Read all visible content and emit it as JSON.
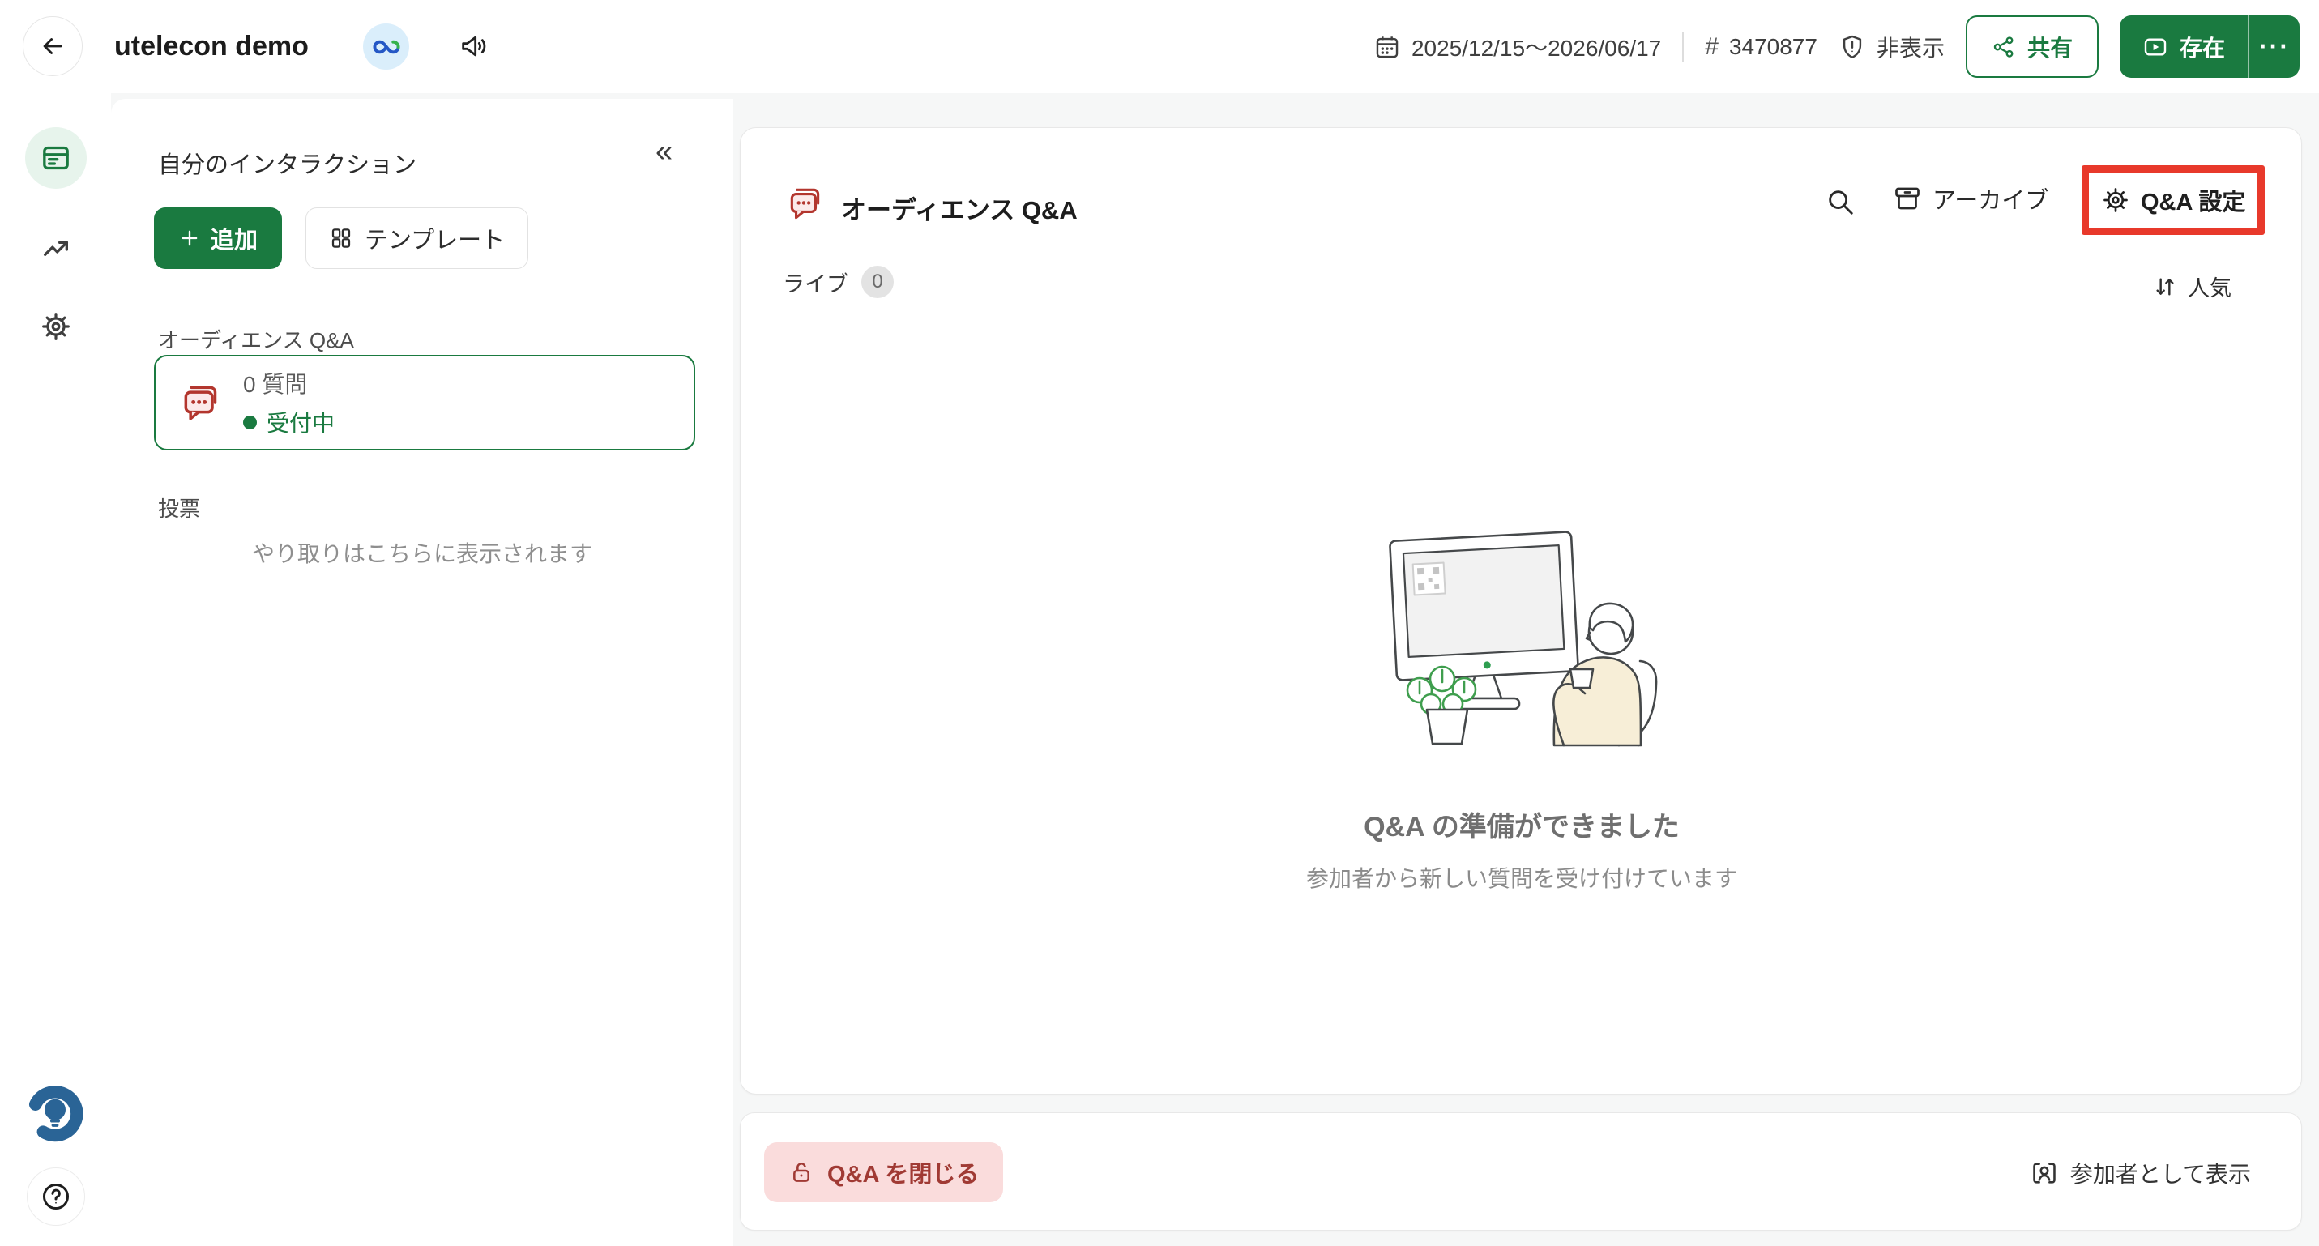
{
  "colors": {
    "green": "#1a7a40",
    "pale-green": "#e7f4ec",
    "qa-red": "#b3362e",
    "qa-pink": "#fceaea",
    "highlight-red": "#e8392b",
    "pink-bg": "#fadcdc",
    "maroon": "#a03a34",
    "slido-blue": "#2a6496",
    "badge-bg": "#e3e3e3"
  },
  "icons": {
    "back-icon": "arrow-left",
    "webex-logo": "infinity-loops",
    "announcement-icon": "speaker-waves",
    "calendar-icon": "calendar",
    "shield-alert-icon": "shield-exclamation",
    "share-icon": "share-nodes",
    "present-icon": "play-screen",
    "more-icon": "ellipsis",
    "interactions-icon": "panel-lines",
    "analytics-icon": "trend-up-arrow",
    "settings-icon": "gear",
    "slido-logo": "bulb-in-arc",
    "help-icon": "question-circle",
    "collapse-icon": "double-chevron-left",
    "add-icon": "plus",
    "template-icon": "grid-2x2",
    "qa-icon": "chat-bubbles",
    "search-icon": "magnifier",
    "archive-icon": "archive-box",
    "sort-icon": "arrows-down-up",
    "unlock-icon": "open-padlock",
    "participant-icon": "person-badge"
  },
  "topbar": {
    "title": "utelecon demo",
    "date_range": "2025/12/15〜2026/06/17",
    "hash_symbol": "#",
    "event_code": "3470877",
    "hidden_label": "非表示",
    "share_label": "共有",
    "present_label": "存在",
    "more_glyph": "···"
  },
  "panel": {
    "title": "自分のインタラクション",
    "collapse_glyph": "«",
    "add_label": "追加",
    "template_label": "テンプレート",
    "qa_section_label": "オーディエンス Q&A",
    "qa_card": {
      "count": "0 質問",
      "status": "受付中"
    },
    "polls_section_label": "投票",
    "hint": "やり取りはこちらに表示されます"
  },
  "main": {
    "title": "オーディエンス Q&A",
    "archive_label": "アーカイブ",
    "settings_label": "Q&A 設定",
    "tabs": {
      "live_label": "ライブ",
      "live_count": "0",
      "sort_label": "人気"
    },
    "empty_state": {
      "heading": "Q&A の準備ができました",
      "subtext": "参加者から新しい質問を受け付けています"
    }
  },
  "footer": {
    "close_label": "Q&A を閉じる",
    "view_as_participant_label": "参加者として表示"
  }
}
